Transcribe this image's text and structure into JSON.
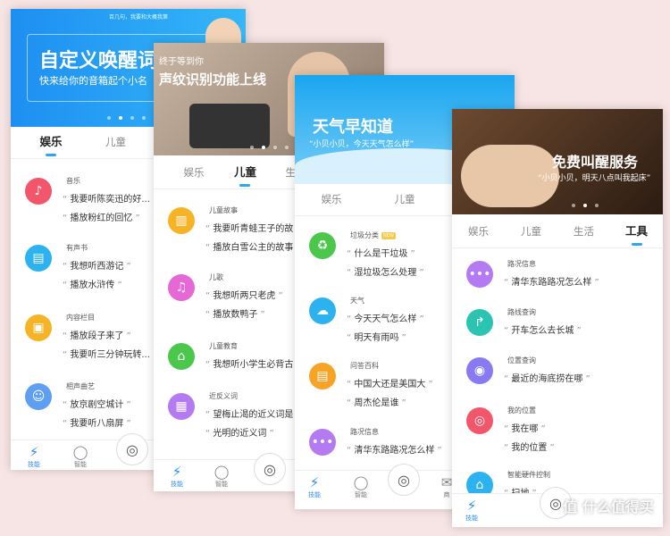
{
  "screens": [
    {
      "banner": {
        "small_text": "百几句，我要和大概我第",
        "title": "自定义唤醒词",
        "subtitle": "快来给你的音箱起个小名"
      },
      "tabs": [
        "娱乐",
        "儿童",
        "生"
      ],
      "items": [
        {
          "category": "音乐",
          "icon": "music-icon",
          "color": "#f2566a",
          "q1": "我要听陈奕迅的好...",
          "q2": "播放粉红的回忆"
        },
        {
          "category": "有声书",
          "icon": "book-icon",
          "color": "#2bb2ef",
          "q1": "我想听西游记",
          "q2": "播放水浒传"
        },
        {
          "category": "内容栏目",
          "icon": "radio-icon",
          "color": "#f7b326",
          "q1": "播放段子来了",
          "q2": "我要听三分钟玩转..."
        },
        {
          "category": "相声曲艺",
          "icon": "mask-icon",
          "color": "#5f9ff3",
          "q1": "放京剧空城计",
          "q2": "我要听八扇屏"
        }
      ],
      "bottom": [
        "技能",
        "智能"
      ]
    },
    {
      "banner": {
        "title_small": "终于等到你",
        "title": "声纹识别功能上线"
      },
      "tabs": [
        "娱乐",
        "儿童",
        "生活"
      ],
      "items": [
        {
          "category": "儿童故事",
          "icon": "storybook-icon",
          "color": "#f7b326",
          "q1": "我要听青蛙王子的故",
          "q2": "播放白雪公主的故事"
        },
        {
          "category": "儿歌",
          "icon": "music-note-icon",
          "color": "#e668d6",
          "q1": "我想听两只老虎",
          "q2": "播放数鸭子"
        },
        {
          "category": "儿童教育",
          "icon": "school-icon",
          "color": "#4bc84b",
          "q1": "我想听小学生必背古"
        },
        {
          "category": "近反义词",
          "icon": "dictionary-icon",
          "color": "#b37af2",
          "q1": "望梅止渴的近义词是",
          "q2": "光明的近义词"
        }
      ],
      "bottom": [
        "技能",
        "智能"
      ]
    },
    {
      "banner": {
        "title": "天气早知道",
        "subtitle": "“小贝小贝，今天天气怎么样”"
      },
      "tabs": [
        "娱乐",
        "儿童",
        "生活"
      ],
      "items": [
        {
          "category": "垃圾分类",
          "badge": "NEW",
          "icon": "recycle-icon",
          "color": "#4bc84b",
          "q1": "什么是干垃圾",
          "q2": "湿垃圾怎么处理"
        },
        {
          "category": "天气",
          "icon": "cloud-icon",
          "color": "#2bb2ef",
          "q1": "今天天气怎么样",
          "q2": "明天有雨吗"
        },
        {
          "category": "问答百科",
          "icon": "encyclopedia-icon",
          "color": "#f7a326",
          "q1": "中国大还是美国大",
          "q2": "周杰伦是谁"
        },
        {
          "category": "路况信息",
          "icon": "traffic-icon",
          "color": "#b37af2",
          "q1": "清华东路路况怎么样"
        }
      ],
      "bottom": [
        "技能",
        "智能",
        "商"
      ]
    },
    {
      "banner": {
        "title": "免费叫醒服务",
        "subtitle": "“小贝小贝，明天八点叫我起床”"
      },
      "tabs": [
        "娱乐",
        "儿童",
        "生活",
        "工具"
      ],
      "items": [
        {
          "category": "路况信息",
          "icon": "traffic-icon",
          "color": "#b37af2",
          "q1": "清华东路路况怎么样"
        },
        {
          "category": "路线查询",
          "icon": "route-icon",
          "color": "#2bc4b2",
          "q1": "开车怎么去长城"
        },
        {
          "category": "位置查询",
          "icon": "location-icon",
          "color": "#8a7af2",
          "q1": "最近的海底捞在哪"
        },
        {
          "category": "我的位置",
          "icon": "my-location-icon",
          "color": "#f2566a",
          "q1": "我在哪",
          "q2": "我的位置"
        },
        {
          "category": "智能硬件控制",
          "icon": "smart-home-icon",
          "color": "#2bb2ef",
          "q1": "扫地"
        }
      ],
      "bottom": [
        "技能"
      ],
      "watermark": "值 什么值得买"
    }
  ]
}
